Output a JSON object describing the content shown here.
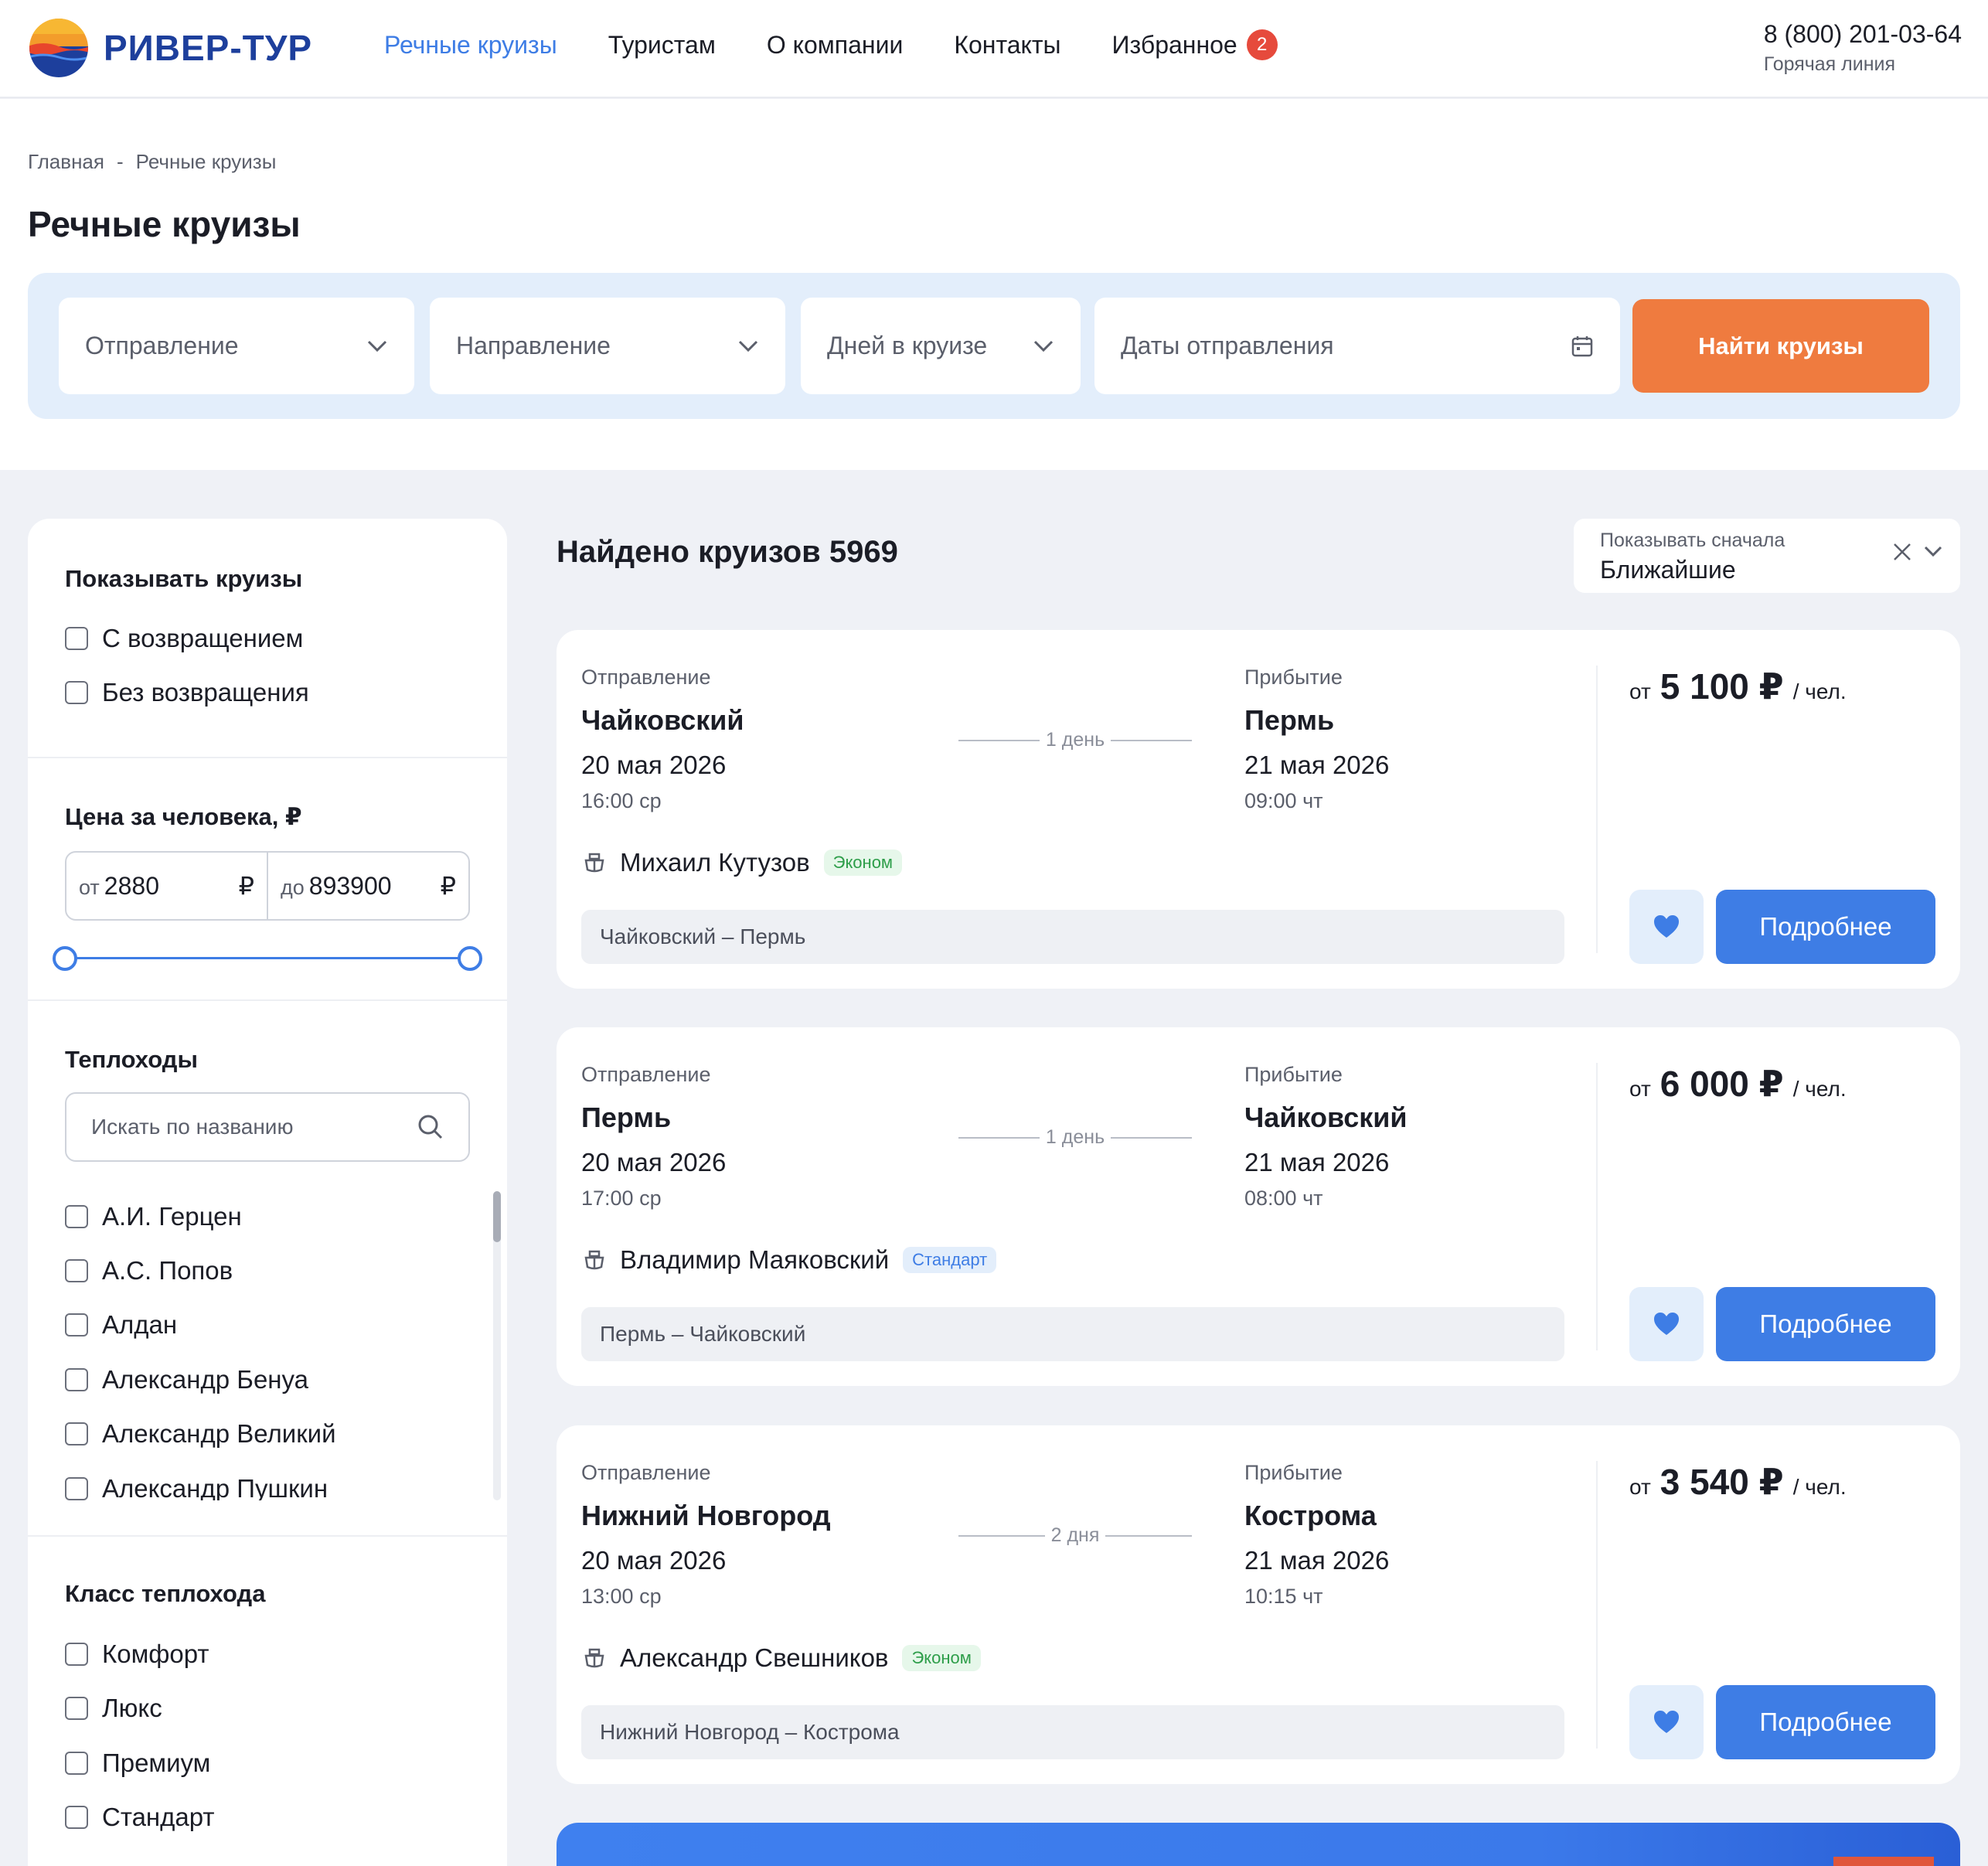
{
  "header": {
    "brand": "РИВЕР-ТУР",
    "nav": [
      {
        "label": "Речные круизы",
        "active": true
      },
      {
        "label": "Туристам",
        "active": false
      },
      {
        "label": "О компании",
        "active": false
      },
      {
        "label": "Контакты",
        "active": false
      },
      {
        "label": "Избранное",
        "active": false
      }
    ],
    "favorites_count": "2",
    "phone": "8 (800) 201-03-64",
    "phone_caption": "Горячая линия"
  },
  "breadcrumb": {
    "home": "Главная",
    "separator": "-",
    "current": "Речные круизы"
  },
  "page_title": "Речные круизы",
  "search": {
    "departure": "Отправление",
    "direction": "Направление",
    "days": "Дней в круизе",
    "dates": "Даты отправления",
    "submit": "Найти круизы"
  },
  "filters": {
    "show_title": "Показывать круизы",
    "show_options": [
      "С возвращением",
      "Без возвращения"
    ],
    "price_title": "Цена за человека, ₽",
    "price_from_prefix": "от",
    "price_from": "2880",
    "price_to_prefix": "до",
    "price_to": "893900",
    "currency": "₽",
    "ships_title": "Теплоходы",
    "ships_search_placeholder": "Искать по названию",
    "ships": [
      "А.И. Герцен",
      "А.С. Попов",
      "Алдан",
      "Александр Бенуа",
      "Александр Великий",
      "Александр Пушкин"
    ],
    "class_title": "Класс теплохода",
    "classes": [
      "Комфорт",
      "Люкс",
      "Премиум",
      "Стандарт"
    ]
  },
  "results": {
    "found_label": "Найдено круизов",
    "found_count": "5969",
    "sort_label": "Показывать сначала",
    "sort_value": "Ближайшие",
    "labels": {
      "departure": "Отправление",
      "arrival": "Прибытие",
      "from": "от",
      "per_person": "/ чел.",
      "details": "Подробнее"
    },
    "cruises": [
      {
        "from_city": "Чайковский",
        "from_date": "20 мая 2026",
        "from_time": "16:00 ср",
        "duration": "1 день",
        "to_city": "Пермь",
        "to_date": "21 мая 2026",
        "to_time": "09:00 чт",
        "ship": "Михаил Кутузов",
        "ship_class": "Эконом",
        "route": "Чайковский – Пермь",
        "price": "5 100 ₽"
      },
      {
        "from_city": "Пермь",
        "from_date": "20 мая 2026",
        "from_time": "17:00 ср",
        "duration": "1 день",
        "to_city": "Чайковский",
        "to_date": "21 мая 2026",
        "to_time": "08:00 чт",
        "ship": "Владимир Маяковский",
        "ship_class": "Стандарт",
        "route": "Пермь – Чайковский",
        "price": "6 000 ₽"
      },
      {
        "from_city": "Нижний Новгород",
        "from_date": "20 мая 2026",
        "from_time": "13:00 ср",
        "duration": "2 дня",
        "to_city": "Кострома",
        "to_date": "21 мая 2026",
        "to_time": "10:15 чт",
        "ship": "Александр Свешников",
        "ship_class": "Эконом",
        "route": "Нижний Новгород – Кострома",
        "price": "3 540 ₽"
      }
    ]
  },
  "colors": {
    "brand": "#1d3f9c",
    "accent": "#3e7de5",
    "cta": "#ef7b3f",
    "badge": "#e64a3c"
  }
}
